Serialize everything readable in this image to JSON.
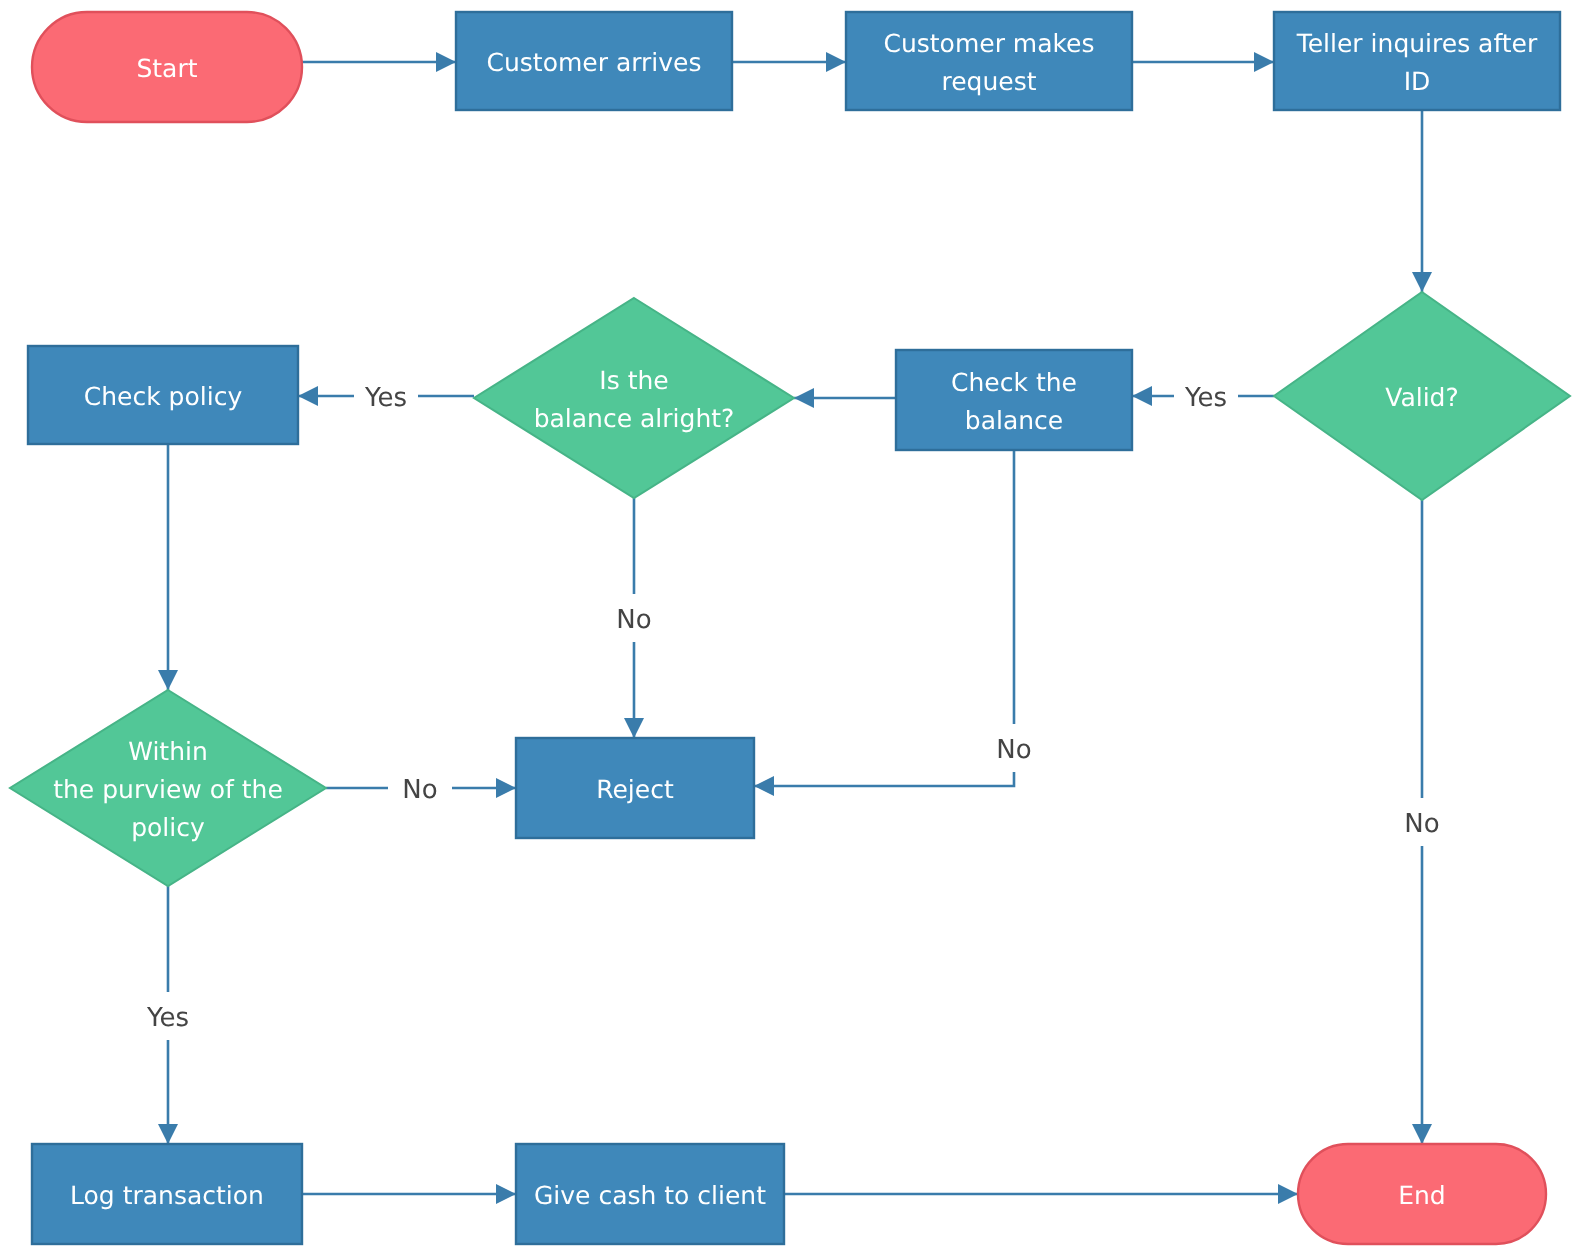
{
  "nodes": [
    {
      "kind": "terminal",
      "lines": [
        "Start"
      ]
    },
    {
      "kind": "process",
      "lines": [
        "Customer arrives"
      ]
    },
    {
      "kind": "process",
      "lines": [
        "Customer makes",
        "request"
      ]
    },
    {
      "kind": "process",
      "lines": [
        "Teller inquires after",
        "ID"
      ]
    },
    {
      "kind": "process",
      "lines": [
        "Check policy"
      ]
    },
    {
      "kind": "decision",
      "lines": [
        "Is the",
        "balance  alright?"
      ]
    },
    {
      "kind": "process",
      "lines": [
        "Check the",
        "balance"
      ]
    },
    {
      "kind": "decision",
      "lines": [
        "Valid?"
      ]
    },
    {
      "kind": "decision",
      "lines": [
        "Within",
        "the purview  of the",
        "policy"
      ]
    },
    {
      "kind": "process",
      "lines": [
        "Reject"
      ]
    },
    {
      "kind": "process",
      "lines": [
        "Log transaction"
      ]
    },
    {
      "kind": "process",
      "lines": [
        "Give cash to client"
      ]
    },
    {
      "kind": "terminal",
      "lines": [
        "End"
      ]
    }
  ],
  "edge_labels": [
    "Yes",
    "Yes",
    "No",
    "No",
    "No",
    "No",
    "Yes"
  ]
}
